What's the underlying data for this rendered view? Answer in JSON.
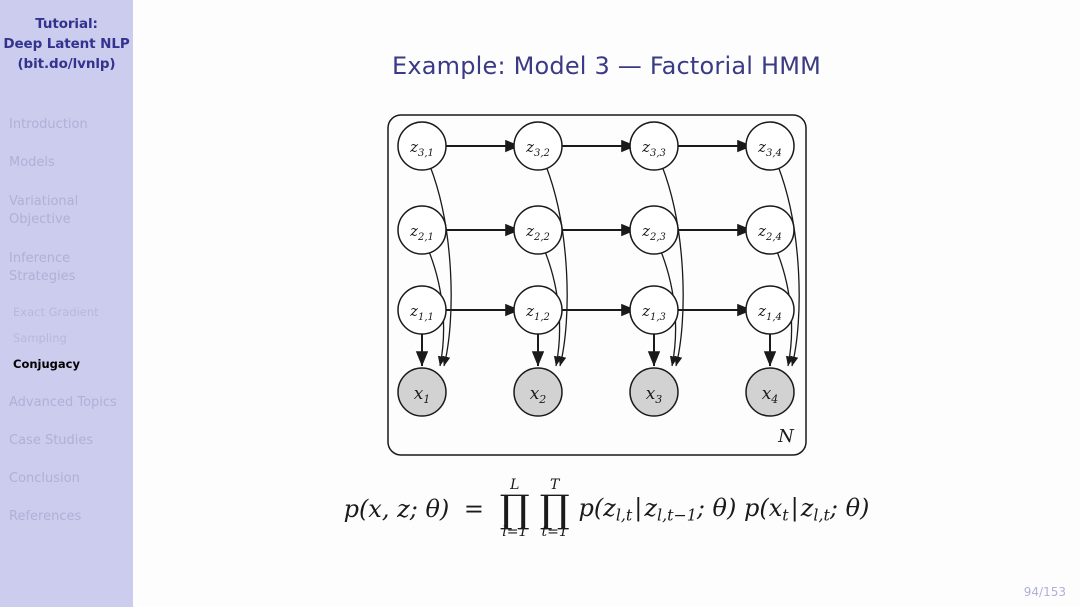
{
  "sidebar": {
    "header_lines": [
      "Tutorial:",
      "Deep Latent NLP",
      "(bit.do/lvnlp)"
    ],
    "background_color": "#ccccee",
    "inactive_color": "#b0b0d8",
    "active_color": "#000000",
    "items": [
      {
        "label": "Introduction",
        "level": "section",
        "current": false
      },
      {
        "label": "Models",
        "level": "section",
        "current": false
      },
      {
        "label": "Variational",
        "level": "section",
        "current": false
      },
      {
        "label": "Objective",
        "level": "section-cont",
        "current": false
      },
      {
        "label": "Inference",
        "level": "section",
        "current": false
      },
      {
        "label": "Strategies",
        "level": "section-cont",
        "current": false
      },
      {
        "label": "Exact Gradient",
        "level": "subsection",
        "current": false
      },
      {
        "label": "Sampling",
        "level": "subsection",
        "current": false
      },
      {
        "label": "Conjugacy",
        "level": "subsection",
        "current": true
      },
      {
        "label": "Advanced Topics",
        "level": "section",
        "current": false
      },
      {
        "label": "Case Studies",
        "level": "section",
        "current": false
      },
      {
        "label": "Conclusion",
        "level": "section",
        "current": false
      },
      {
        "label": "References",
        "level": "section",
        "current": false
      }
    ]
  },
  "header": {
    "title": "Example: Model 3 — Factorial HMM",
    "title_color": "#3b3b85"
  },
  "figure": {
    "name": "factorial-hmm-plate-diagram",
    "plate_label": "N",
    "node_fill_latent": "#ffffff",
    "node_fill_observed": "#d2d2d2",
    "stroke_color": "#1a1a1a",
    "latent_rows": [
      {
        "row": 3,
        "nodes": [
          "z",
          "3,1",
          "3,2",
          "3,3",
          "3,4"
        ]
      },
      {
        "row": 2,
        "nodes": [
          "z",
          "2,1",
          "2,2",
          "2,3",
          "2,4"
        ]
      },
      {
        "row": 1,
        "nodes": [
          "z",
          "1,1",
          "1,2",
          "1,3",
          "1,4"
        ]
      }
    ],
    "latent_labels": [
      [
        "z",
        "3,1"
      ],
      [
        "z",
        "3,2"
      ],
      [
        "z",
        "3,3"
      ],
      [
        "z",
        "3,4"
      ],
      [
        "z",
        "2,1"
      ],
      [
        "z",
        "2,2"
      ],
      [
        "z",
        "2,3"
      ],
      [
        "z",
        "2,4"
      ],
      [
        "z",
        "1,1"
      ],
      [
        "z",
        "1,2"
      ],
      [
        "z",
        "1,3"
      ],
      [
        "z",
        "1,4"
      ]
    ],
    "observed_labels": [
      [
        "x",
        "1"
      ],
      [
        "x",
        "2"
      ],
      [
        "x",
        "3"
      ],
      [
        "x",
        "4"
      ]
    ]
  },
  "formula": {
    "lhs": "p(x, z; θ)",
    "equals": "=",
    "products": [
      {
        "symbol": "∏",
        "upper": "L",
        "lower": "l=1"
      },
      {
        "symbol": "∏",
        "upper": "T",
        "lower": "t=1"
      }
    ],
    "p1_open": "p(z",
    "p1_sub1": "l,t",
    "p1_bar": "|",
    "p1_sub2_base": "z",
    "p1_sub2": "l,t−1",
    "p1_close": "; θ)",
    "p2_open": "p(x",
    "p2_sub1": "t",
    "p2_bar": "|",
    "p2_sub2_base": "z",
    "p2_sub2": "l,t",
    "p2_close": "; θ)",
    "plain_text": "p(x, z; θ) = ∏(l=1..L) ∏(t=1..T) p(z_{l,t} | z_{l,t−1}; θ) p(x_t | z_{l,t}; θ)"
  },
  "footer": {
    "page_indicator": "94/153",
    "color": "#b0b0d8"
  }
}
